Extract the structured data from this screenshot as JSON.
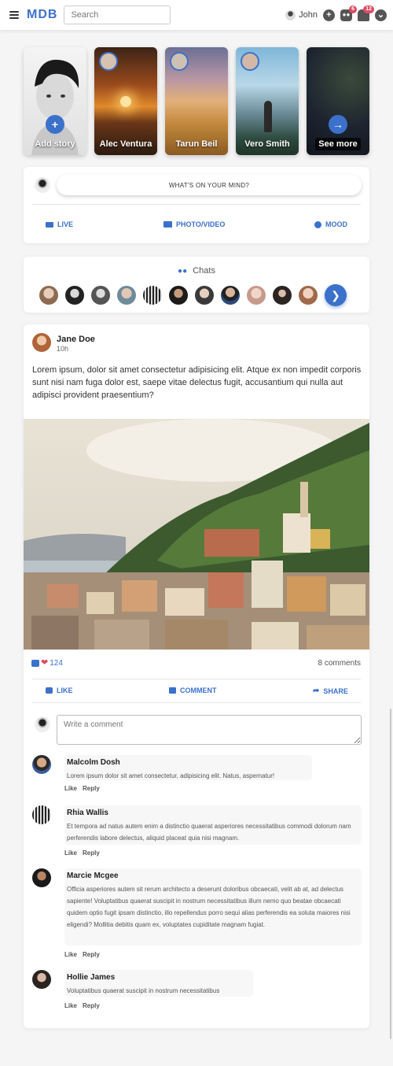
{
  "navbar": {
    "logo": "MDB",
    "search_placeholder": "Search",
    "user_name": "John",
    "messages_badge": "6",
    "notifications_badge": "12"
  },
  "stories": [
    {
      "label": "Add story",
      "type": "add"
    },
    {
      "label": "Alec Ventura",
      "type": "user"
    },
    {
      "label": "Tarun Beil",
      "type": "user"
    },
    {
      "label": "Vero Smith",
      "type": "user"
    },
    {
      "label": "See more",
      "type": "more"
    }
  ],
  "composer": {
    "prompt": "WHAT'S ON YOUR MIND?",
    "live": "LIVE",
    "photo": "PHOTO/VIDEO",
    "mood": "MOOD"
  },
  "chats": {
    "title": "Chats"
  },
  "post": {
    "author": "Jane Doe",
    "time": "10h",
    "text": "Lorem ipsum, dolor sit amet consectetur adipisicing elit. Atque ex non impedit corporis sunt nisi nam fuga dolor est, saepe vitae delectus fugit, accusantium qui nulla aut adipisci provident praesentium?",
    "reaction_count": "124",
    "comments_count": "8 comments",
    "like": "LIKE",
    "comment": "COMMENT",
    "share": "SHARE",
    "comment_placeholder": "Write a comment"
  },
  "comments": [
    {
      "name": "Malcolm Dosh",
      "text": "Lorem ipsum dolor sit amet consectetur, adipisicing elit. Natus, aspernatur!",
      "like": "Like",
      "reply": "Reply"
    },
    {
      "name": "Rhia Wallis",
      "text": "Et tempora ad natus autem enim a distinctio quaerat asperiores necessitatibus commodi dolorum nam perferendis labore delectus, aliquid placeat quia nisi magnam.",
      "like": "Like",
      "reply": "Reply"
    },
    {
      "name": "Marcie Mcgee",
      "text": "Officia asperiores autem sit rerum architecto a deserunt doloribus obcaecati, velit ab at, ad delectus sapiente! Voluptatibus quaerat suscipit in nostrum necessitatibus illum nemo quo beatae obcaecati quidem optio fugit ipsam distinctio, illo repellendus porro sequi alias perferendis ea soluta maiores nisi eligendi? Mollitia debitis quam ex, voluptates cupiditate magnam fugiat.",
      "like": "Like",
      "reply": "Reply"
    },
    {
      "name": "Hollie James",
      "text": "Voluptatibus quaerat suscipit in nostrum necessitatibus",
      "like": "Like",
      "reply": "Reply"
    }
  ],
  "colors": {
    "primary": "#3b71ca",
    "danger": "#dc4c64"
  }
}
